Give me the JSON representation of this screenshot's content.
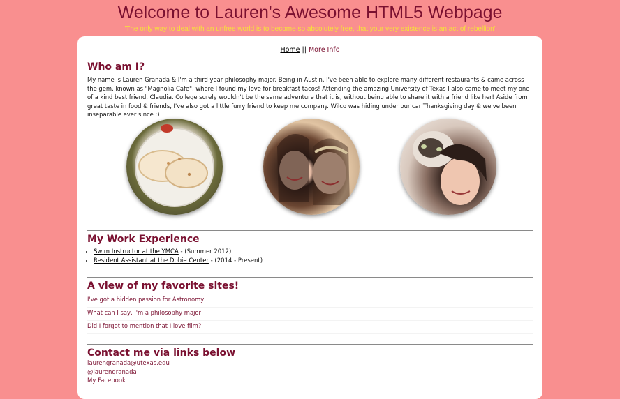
{
  "header": {
    "title": "Welcome to Lauren's Awesome HTML5 Webpage",
    "quote": "\"The only way to deal with an unfree world is to become so absolutely free, that your very existence is an act of rebellion\""
  },
  "nav": {
    "home": "Home",
    "separator": "||",
    "more_info": "More Info"
  },
  "about": {
    "heading": "Who am I?",
    "body": "My name is Lauren Granada & I'm a third year philosophy major. Being in Austin, I've been able to explore many different restaurants & came across the gem, known as \"Magnolia Cafe\", where I found my love for breakfast tacos! Attending the amazing University of Texas I also came to meet my one of a kind best friend, Claudia. College surely wouldn't be the same adventure that it is, without being able to share it with a friend like her! Aside from great taste in food & friends, I've also got a little furry friend to keep me company. Wilco was hiding under our car Thanksgiving day & we've been inseparable ever since :)"
  },
  "work": {
    "heading": "My Work Experience",
    "items": [
      {
        "link": "Swim Instructor at the YMCA",
        "detail": " - (Summer 2012)"
      },
      {
        "link": "Resident Assistant at the Dobie Center",
        "detail": " - (2014 - Present)"
      }
    ]
  },
  "sites": {
    "heading": "A view of my favorite sites!",
    "links": [
      "I've got a hidden passion for Astronomy",
      "What can I say, I'm a philosophy major",
      "Did I forgot to mention that I love film?"
    ]
  },
  "contact": {
    "heading": "Contact me via links below",
    "email": "laurengranada@utexas.edu",
    "twitter": "@laurengranada",
    "facebook": "My Facebook"
  }
}
